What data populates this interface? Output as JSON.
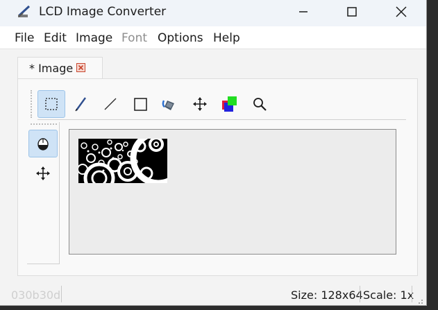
{
  "window": {
    "title": "LCD Image Converter",
    "icon": "paint-brush-icon"
  },
  "menu": {
    "items": [
      {
        "label": "File",
        "enabled": true
      },
      {
        "label": "Edit",
        "enabled": true
      },
      {
        "label": "Image",
        "enabled": true
      },
      {
        "label": "Font",
        "enabled": false
      },
      {
        "label": "Options",
        "enabled": true
      },
      {
        "label": "Help",
        "enabled": true
      }
    ]
  },
  "tabs": [
    {
      "label": "* Image",
      "close_icon": "close-icon"
    }
  ],
  "toolbar": {
    "tools": [
      {
        "name": "selection-tool",
        "icon": "dashed-rectangle-icon",
        "active": true
      },
      {
        "name": "pen-tool",
        "icon": "pen-icon",
        "active": false
      },
      {
        "name": "line-tool",
        "icon": "line-icon",
        "active": false
      },
      {
        "name": "rectangle-tool",
        "icon": "rectangle-icon",
        "active": false
      },
      {
        "name": "fill-tool",
        "icon": "paint-bucket-icon",
        "active": false
      },
      {
        "name": "move-tool",
        "icon": "move-arrows-icon",
        "active": false
      },
      {
        "name": "color-tool",
        "icon": "color-squares-icon",
        "active": false
      },
      {
        "name": "zoom-tool",
        "icon": "magnifier-icon",
        "active": false
      }
    ]
  },
  "side_toolbar": {
    "tools": [
      {
        "name": "mouse-tool",
        "icon": "mouse-icon",
        "active": true
      },
      {
        "name": "pan-tool",
        "icon": "move-arrows-icon",
        "active": false
      }
    ]
  },
  "status": {
    "color_value": "030b30d",
    "size": "Size: 128x64",
    "scale": "Scale: 1x"
  },
  "colors": {
    "accent": "#cfe3f6",
    "close_red": "#c8462e"
  }
}
